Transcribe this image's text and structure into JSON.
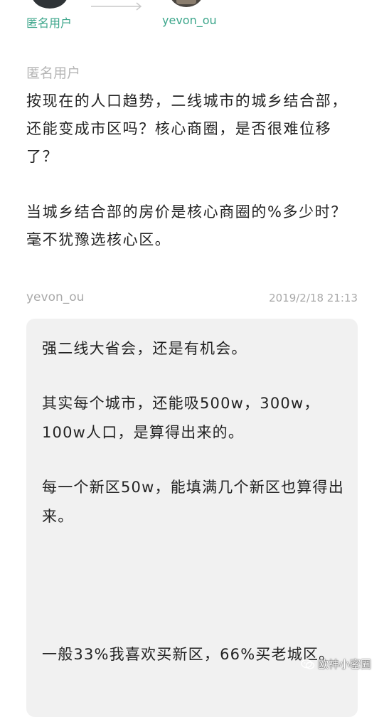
{
  "header": {
    "left_name": "匿名用户",
    "right_name": "yevon_ou"
  },
  "question": {
    "author": "匿名用户",
    "paragraphs": [
      "按现在的人口趋势，二线城市的城乡结合部，还能变成市区吗？核心商圈，是否很难位移了？",
      "当城乡结合部的房价是核心商圈的%多少时？毫不犹豫选核心区。"
    ]
  },
  "answer": {
    "author": "yevon_ou",
    "timestamp": "2019/2/18 21:13",
    "paragraphs": [
      "强二线大省会，还是有机会。",
      "其实每个城市，还能吸500w，300w，100w人口，是算得出来的。",
      "每一个新区50w，能填满几个新区也算得出来。",
      "一般33%我喜欢买新区，66%买老城区。"
    ]
  },
  "watermark": {
    "text": "欧神小密圈",
    "icon": "wechat-icon"
  },
  "colors": {
    "accent_green": "#3ba58a",
    "meta_gray": "#a9a9a9",
    "card_bg": "#f1f1f1"
  }
}
